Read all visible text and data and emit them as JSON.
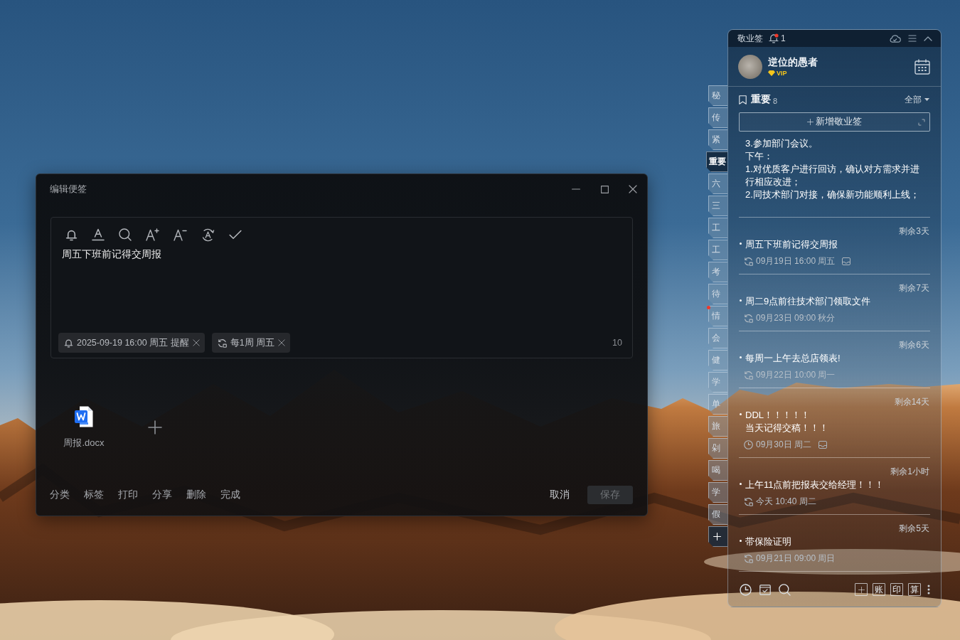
{
  "editor_window": {
    "title": "编辑便签",
    "content": "周五下班前记得交周报",
    "chips": [
      {
        "kind": "reminder",
        "label": "2025-09-19 16:00 周五 提醒"
      },
      {
        "kind": "repeat",
        "label": "每1周 周五"
      }
    ],
    "char_count": "10",
    "attachments": [
      {
        "name": "周报.docx"
      }
    ],
    "actions": [
      "分类",
      "标签",
      "打印",
      "分享",
      "删除",
      "完成"
    ],
    "cancel": "取消",
    "save": {
      "label": "保存",
      "disabled": true
    }
  },
  "sticky_panel": {
    "title": "敬业签",
    "notification_count": "1",
    "user": {
      "name": "逆位的愚者",
      "badge": "VIP"
    },
    "category_tabs": [
      {
        "label": "秘",
        "selected": false,
        "unread": false
      },
      {
        "label": "传",
        "selected": false,
        "unread": false
      },
      {
        "label": "紧",
        "selected": false,
        "unread": false
      },
      {
        "label": "重要",
        "selected": true,
        "unread": false
      },
      {
        "label": "六",
        "selected": false,
        "unread": false
      },
      {
        "label": "三",
        "selected": false,
        "unread": false
      },
      {
        "label": "工",
        "selected": false,
        "unread": false
      },
      {
        "label": "工",
        "selected": false,
        "unread": false
      },
      {
        "label": "考",
        "selected": false,
        "unread": false
      },
      {
        "label": "待",
        "selected": false,
        "unread": false
      },
      {
        "label": "情",
        "selected": false,
        "unread": true
      },
      {
        "label": "会",
        "selected": false,
        "unread": false
      },
      {
        "label": "健",
        "selected": false,
        "unread": false
      },
      {
        "label": "学",
        "selected": false,
        "unread": false
      },
      {
        "label": "单",
        "selected": false,
        "unread": false
      },
      {
        "label": "旅",
        "selected": false,
        "unread": false
      },
      {
        "label": "剁",
        "selected": false,
        "unread": false
      },
      {
        "label": "喝",
        "selected": false,
        "unread": false
      },
      {
        "label": "学",
        "selected": false,
        "unread": false
      },
      {
        "label": "假",
        "selected": false,
        "unread": false
      }
    ],
    "section": {
      "title": "重要",
      "count": "8",
      "filter": "全部"
    },
    "new_button": "新增敬业签",
    "preview_lines": [
      "3.参加部门会议。",
      "下午：",
      "1.对优质客户进行回访，确认对方需求并进行相应改进；",
      "2.同技术部门对接，确保新功能顺利上线；"
    ],
    "notes": [
      {
        "remaining": "剩余3天",
        "title_lines": [
          "周五下班前记得交周报"
        ],
        "kind": "repeat",
        "time": "09月19日 16:00 周五",
        "attachment": true
      },
      {
        "remaining": "剩余7天",
        "title_lines": [
          "周二9点前往技术部门领取文件"
        ],
        "kind": "repeat",
        "time": "09月23日 09:00 秋分",
        "attachment": false
      },
      {
        "remaining": "剩余6天",
        "title_lines": [
          "每周一上午去总店领表!"
        ],
        "kind": "repeat",
        "time": "09月22日 10:00 周一",
        "attachment": false
      },
      {
        "remaining": "剩余14天",
        "title_lines": [
          "DDL！！！！！",
          "当天记得交稿！！！"
        ],
        "kind": "timed",
        "time": "09月30日 周二",
        "attachment": true
      },
      {
        "remaining": "剩余1小时",
        "title_lines": [
          "上午11点前把报表交给经理！！！"
        ],
        "kind": "repeat",
        "time": "今天 10:40 周二",
        "attachment": false
      },
      {
        "remaining": "剩余5天",
        "title_lines": [
          "带保险证明"
        ],
        "kind": "repeat",
        "time": "09月21日 09:00 周日",
        "attachment": false
      }
    ],
    "tools": [
      "账",
      "印",
      "算"
    ]
  }
}
